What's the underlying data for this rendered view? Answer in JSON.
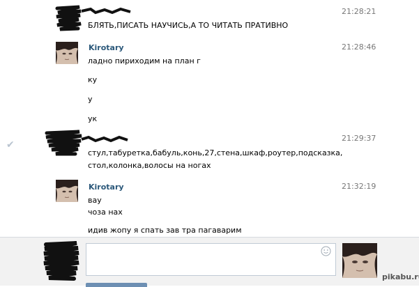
{
  "messages": [
    {
      "author": "",
      "time": "21:28:21",
      "lines": [
        "БЛЯТЬ,ПИСАТЬ НАУЧИСЬ,А ТО ЧИТАТЬ ПРАТИВНО"
      ]
    },
    {
      "author": "Kirotary",
      "time": "21:28:46",
      "lines": [
        "ладно пириходим на план г",
        "ку",
        "у",
        "ук"
      ]
    },
    {
      "author": "",
      "time": "21:29:37",
      "lines": [
        "стул,табуретка,бабуль,конь,27,стена,шкаф,роутер,подсказка,",
        "стол,колонка,волосы на ногах"
      ]
    },
    {
      "author": "Kirotary",
      "time": "21:32:19",
      "lines": [
        "вау",
        "чоза нах",
        "идив жопу я спать зав тра пагаварим"
      ]
    }
  ],
  "composer": {
    "text": "",
    "emoji_icon": "smile-icon"
  },
  "watermark": "pikabu.ru",
  "colors": {
    "author": "#2b587a",
    "time": "#777777",
    "composer_bg": "#f2f2f2"
  }
}
